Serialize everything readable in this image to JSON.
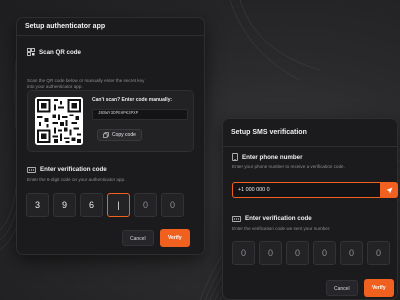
{
  "auth_card": {
    "title": "Setup authenticator app",
    "scan_title": "Scan QR code",
    "scan_desc_line1": "Scan the QR code below or manually enter the secret key",
    "scan_desc_line2": "into your authenticator app.",
    "cant_scan": "Can't scan? Enter code manually:",
    "secret_key": "JBSWY3DPEHPK3PXP",
    "copy_label": "Copy code",
    "verify_title": "Enter verification code",
    "verify_desc": "Enter the 6-digit code on your authenticator app.",
    "digits": [
      "3",
      "9",
      "6",
      "|",
      "0",
      "0"
    ],
    "cancel_label": "Cancel",
    "verify_label": "Verify"
  },
  "sms_card": {
    "title": "Setup SMS verification",
    "phone_title": "Enter phone number",
    "phone_desc": "Enter your phone number to receive a verification code.",
    "phone_value": "+1 000 000 0",
    "code_title": "Enter verification code",
    "code_desc": "Enter the verification code we sent your number.",
    "digits": [
      "0",
      "0",
      "0",
      "0",
      "0",
      "0"
    ],
    "cancel_label": "Cancel",
    "verify_label": "Verify"
  },
  "colors": {
    "accent": "#f0611f",
    "card_bg": "#1b1b1d",
    "page_bg": "#2a2a2c"
  }
}
